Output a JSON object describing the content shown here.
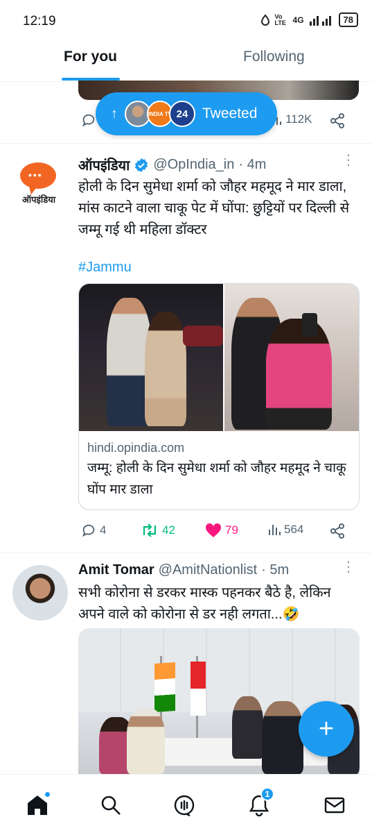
{
  "status_bar": {
    "time": "12:19",
    "network_label": "Vo LTE",
    "signal_label": "4G",
    "battery": "78"
  },
  "tabs": [
    {
      "label": "For you",
      "active": true
    },
    {
      "label": "Following",
      "active": false
    }
  ],
  "previous_tweet": {
    "views": "112K"
  },
  "tweeted_pill": {
    "label": "Tweeted",
    "avatars": [
      "user-photo",
      "INDIA TV",
      "24"
    ]
  },
  "tweets": [
    {
      "name": "ऑपइंडिया",
      "verified": true,
      "handle": "@OpIndia_in",
      "time": "· 4m",
      "avatar_label": "ऑपइंडिया",
      "text": "होली के दिन सुमेधा शर्मा को जौहर महमूद ने मार डाला, मांस काटने वाला चाकू पेट में घोंपा: छुट्टियों पर दिल्ली से जम्मू गई थी महिला डॉक्टर",
      "hashtag": "#Jammu",
      "card": {
        "domain": "hindi.opindia.com",
        "title": "जम्मू: होली के दिन सुमेधा शर्मा को जौहर महमूद ने चाकू घोंप मार डाला"
      },
      "stats": {
        "replies": "4",
        "retweets": "42",
        "likes": "79",
        "views": "564"
      }
    },
    {
      "name": "Amit Tomar",
      "verified": false,
      "handle": "@AmitNationlist",
      "time": "· 5m",
      "text": "सभी कोरोना से डरकर मास्क पहनकर बैठे है, लेकिन अपने वाले को कोरोना से डर नही लगता...🤣"
    }
  ],
  "fab": {
    "icon": "plus-icon"
  },
  "bottom_nav": {
    "items": [
      "home-icon",
      "search-icon",
      "spaces-icon",
      "notifications-icon",
      "messages-icon"
    ],
    "notification_count": "1"
  },
  "colors": {
    "accent": "#1d9bf0",
    "retweet": "#00ba7c",
    "like": "#f91880",
    "secondary_text": "#536471"
  }
}
